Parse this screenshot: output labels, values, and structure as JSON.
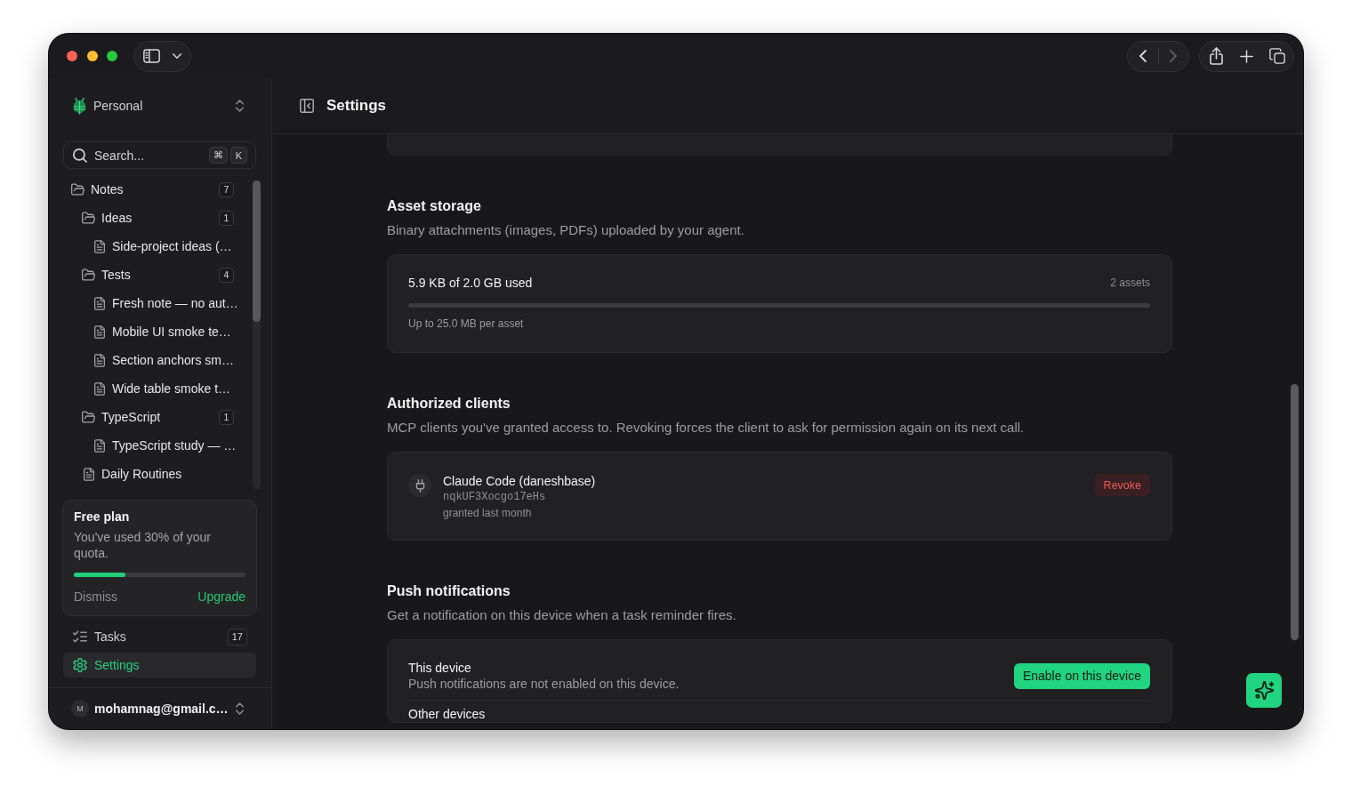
{
  "window": {
    "nav_buttons": [
      {
        "kind": "back",
        "disabled": false
      },
      {
        "kind": "forward",
        "disabled": true
      }
    ]
  },
  "sidebar": {
    "workspace": "Personal",
    "search": {
      "placeholder": "Search...",
      "keys": [
        "⌘",
        "K"
      ]
    },
    "tree": [
      {
        "kind": "folder",
        "label": "Notes",
        "count": "7",
        "expanded": true,
        "selected": false,
        "children": [
          {
            "kind": "folder",
            "label": "Ideas",
            "count": "1",
            "expanded": true,
            "selected": false,
            "children": [
              {
                "kind": "note",
                "label": "Side-project ideas (…",
                "selected": false
              }
            ]
          },
          {
            "kind": "folder",
            "label": "Tests",
            "count": "4",
            "expanded": true,
            "selected": false,
            "children": [
              {
                "kind": "note",
                "label": "Fresh note — no aut…",
                "selected": false
              },
              {
                "kind": "note",
                "label": "Mobile UI smoke te…",
                "selected": false
              },
              {
                "kind": "note",
                "label": "Section anchors sm…",
                "selected": false
              },
              {
                "kind": "note",
                "label": "Wide table smoke t…",
                "selected": false
              }
            ]
          },
          {
            "kind": "folder",
            "label": "TypeScript",
            "count": "1",
            "expanded": true,
            "selected": false,
            "children": [
              {
                "kind": "note",
                "label": "TypeScript study — …",
                "selected": false
              }
            ]
          },
          {
            "kind": "note",
            "label": "Daily Routines",
            "selected": false
          }
        ]
      }
    ],
    "plan": {
      "title": "Free plan",
      "text": "You've used 30% of your quota.",
      "level": 0.3,
      "dismiss": "Dismiss",
      "upgrade": "Upgrade"
    },
    "nav": [
      {
        "kind": "tasks",
        "label": "Tasks",
        "count": "17",
        "selected": false
      },
      {
        "kind": "settings",
        "label": "Settings",
        "selected": true
      }
    ],
    "account": {
      "avatar": "M",
      "email": "mohamnag@gmail.c…"
    }
  },
  "header": {
    "title": "Settings"
  },
  "sections": [
    {
      "kind": "storage",
      "title": "Asset storage",
      "description": "Binary attachments (images, PDFs) uploaded by your agent.",
      "usage": "5.9 KB of 2.0 GB used",
      "count": "2 assets",
      "level": 0,
      "note": "Up to 25.0 MB per asset"
    },
    {
      "kind": "clients",
      "title": "Authorized clients",
      "description": "MCP clients you've granted access to. Revoking forces the client to ask for permission again on its next call.",
      "clients": [
        {
          "name": "Claude Code (daneshbase)",
          "id": "nqkUF3Xocgo17eHs",
          "granted": "granted last month",
          "action": "Revoke"
        }
      ]
    },
    {
      "kind": "push",
      "title": "Push notifications",
      "description": "Get a notification on this device when a task reminder fires.",
      "device": {
        "title": "This device",
        "status": "Push notifications are not enabled on this device.",
        "action": "Enable on this device"
      },
      "other_heading": "Other devices"
    }
  ]
}
